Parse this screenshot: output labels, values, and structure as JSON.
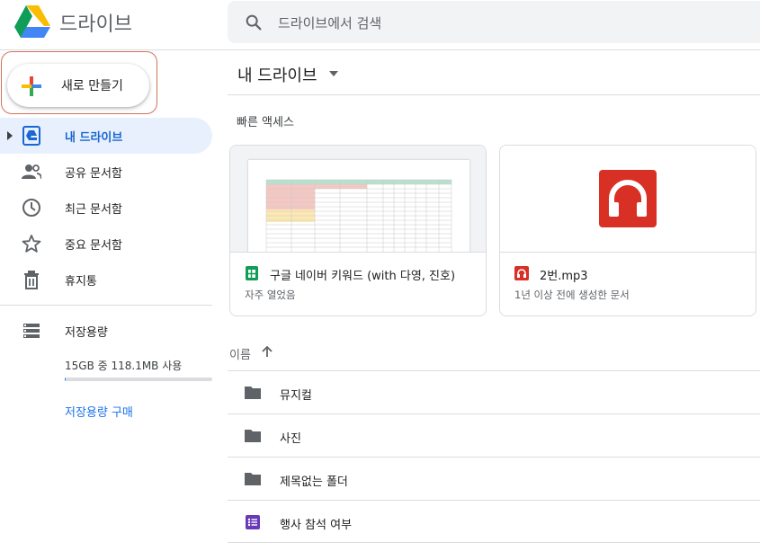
{
  "app": {
    "title": "드라이브"
  },
  "search": {
    "placeholder": "드라이브에서 검색"
  },
  "sidebar": {
    "new_label": "새로 만들기",
    "items": [
      {
        "label": "내 드라이브",
        "icon": "my-drive-icon",
        "active": true
      },
      {
        "label": "공유 문서함",
        "icon": "shared-people-icon"
      },
      {
        "label": "최근 문서함",
        "icon": "clock-icon"
      },
      {
        "label": "중요 문서함",
        "icon": "star-icon"
      },
      {
        "label": "휴지통",
        "icon": "trash-icon"
      }
    ],
    "storage": {
      "title": "저장용량",
      "usage": "15GB 중 118.1MB 사용",
      "used_fraction": 0.008,
      "buy_label": "저장용량 구매"
    }
  },
  "main": {
    "title": "내 드라이브",
    "quick_access": {
      "title": "빠른 액세스",
      "cards": [
        {
          "name": "구글 네이버 키워드 (with 다영, 진호)",
          "subtitle": "자주 열었음",
          "icon": "sheets-icon"
        },
        {
          "name": "2번.mp3",
          "subtitle": "1년 이상 전에 생성한 문서",
          "icon": "audio-icon"
        }
      ]
    },
    "sort": {
      "label": "이름",
      "icon": "arrow-up-icon"
    },
    "files": [
      {
        "name": "뮤지컬",
        "icon": "folder-icon"
      },
      {
        "name": "사진",
        "icon": "folder-icon"
      },
      {
        "name": "제목없는 폴더",
        "icon": "folder-icon"
      },
      {
        "name": "행사 참석 여부",
        "icon": "forms-icon"
      }
    ]
  },
  "colors": {
    "accent": "#1a73e8",
    "active_bg": "#e8f0fe",
    "highlight_outline": "#d0735a",
    "audio_red": "#d93025",
    "sheets_green": "#0f9d58",
    "forms_purple": "#673ab7",
    "icon_gray": "#5f6368"
  }
}
